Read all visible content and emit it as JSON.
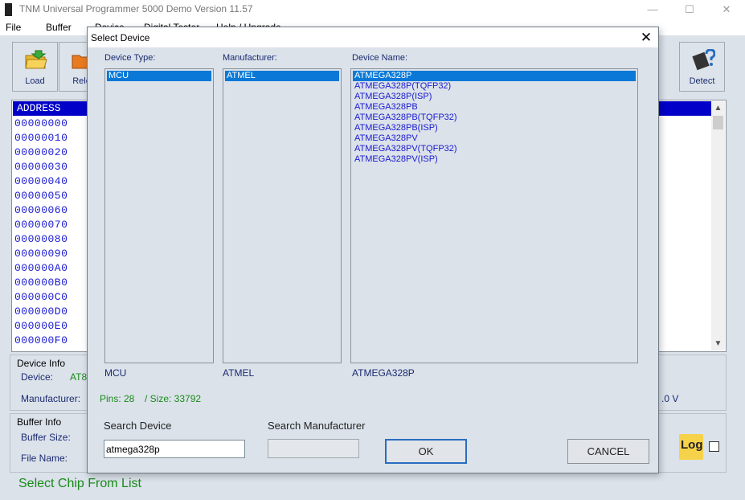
{
  "window": {
    "title": "TNM  Universal Programmer 5000 Demo   Version 11.57",
    "minimize": "—",
    "maximize": "☐",
    "close": "✕"
  },
  "menu": [
    "File",
    "Buffer",
    "Device",
    "Digital Tester",
    "Help / Upgrade"
  ],
  "toolbar": {
    "load_label": "Load",
    "reload_label": "Relo",
    "detect_label": "Detect"
  },
  "hexview": {
    "header": "ADDRESS",
    "rows": [
      "00000000",
      "00000010",
      "00000020",
      "00000030",
      "00000040",
      "00000050",
      "00000060",
      "00000070",
      "00000080",
      "00000090",
      "000000A0",
      "000000B0",
      "000000C0",
      "000000D0",
      "000000E0",
      "000000F0"
    ]
  },
  "device_info": {
    "title": "Device Info",
    "device_label": "Device:",
    "device_value": "AT8",
    "manufacturer_label": "Manufacturer:",
    "voltage_value": ".0 V"
  },
  "buffer_info": {
    "title": "Buffer Info",
    "size_label": "Buffer Size:",
    "file_label": "File Name:"
  },
  "status": "Select Chip From List",
  "log_label": "Log",
  "dialog": {
    "title": "Select Device",
    "close": "✕",
    "device_type_label": "Device Type:",
    "manufacturer_label": "Manufacturer:",
    "device_name_label": "Device Name:",
    "device_types": [
      "MCU"
    ],
    "manufacturers": [
      "ATMEL"
    ],
    "device_names": [
      "ATMEGA328P",
      "ATMEGA328P(TQFP32)",
      "ATMEGA328P(ISP)",
      "ATMEGA328PB",
      "ATMEGA328PB(TQFP32)",
      "ATMEGA328PB(ISP)",
      "ATMEGA328PV",
      "ATMEGA328PV(TQFP32)",
      "ATMEGA328PV(ISP)"
    ],
    "selected_type": "MCU",
    "selected_manufacturer": "ATMEL",
    "selected_device": "ATMEGA328P",
    "pins": "Pins: 28",
    "size": "/ Size: 33792",
    "search_device_label": "Search Device",
    "search_device_value": "atmega328p",
    "search_manufacturer_label": "Search Manufacturer",
    "search_manufacturer_value": "",
    "ok_label": "OK",
    "cancel_label": "CANCEL"
  }
}
